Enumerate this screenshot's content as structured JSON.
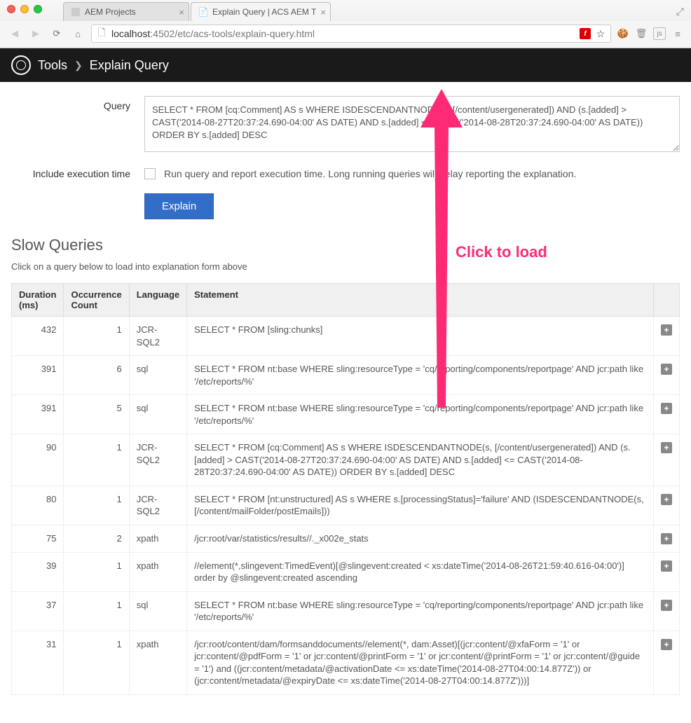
{
  "browser": {
    "tabs": [
      {
        "title": "AEM Projects",
        "active": false
      },
      {
        "title": "Explain Query | ACS AEM T",
        "active": true
      }
    ],
    "url_host": "localhost",
    "url_port": ":4502",
    "url_path": "/etc/acs-tools/explain-query.html"
  },
  "header": {
    "breadcrumb_root": "Tools",
    "breadcrumb_current": "Explain Query"
  },
  "form": {
    "query_label": "Query",
    "query_value": "SELECT * FROM [cq:Comment] AS s WHERE ISDESCENDANTNODE(s, [/content/usergenerated]) AND (s.[added] > CAST('2014-08-27T20:37:24.690-04:00' AS DATE) AND s.[added] <= CAST('2014-08-28T20:37:24.690-04:00' AS DATE)) ORDER BY s.[added] DESC",
    "exec_label": "Include execution time",
    "exec_desc": "Run query and report execution time. Long running queries will delay reporting the explanation.",
    "explain_btn": "Explain"
  },
  "section": {
    "title": "Slow Queries",
    "subtitle": "Click on a query below to load into explanation form above"
  },
  "table": {
    "headers": {
      "duration": "Duration (ms)",
      "occurrence": "Occurrence Count",
      "language": "Language",
      "statement": "Statement"
    },
    "rows": [
      {
        "duration": "432",
        "occurrence": "1",
        "language": "JCR-SQL2",
        "statement": "SELECT * FROM [sling:chunks]"
      },
      {
        "duration": "391",
        "occurrence": "6",
        "language": "sql",
        "statement": "SELECT * FROM nt:base WHERE sling:resourceType = 'cq/reporting/components/reportpage' AND jcr:path like '/etc/reports/%'"
      },
      {
        "duration": "391",
        "occurrence": "5",
        "language": "sql",
        "statement": "SELECT * FROM nt:base WHERE sling:resourceType = 'cq/reporting/components/reportpage' AND jcr:path like '/etc/reports/%'"
      },
      {
        "duration": "90",
        "occurrence": "1",
        "language": "JCR-SQL2",
        "statement": "SELECT * FROM [cq:Comment] AS s WHERE ISDESCENDANTNODE(s, [/content/usergenerated]) AND (s.[added] > CAST('2014-08-27T20:37:24.690-04:00' AS DATE) AND s.[added] <= CAST('2014-08-28T20:37:24.690-04:00' AS DATE)) ORDER BY s.[added] DESC"
      },
      {
        "duration": "80",
        "occurrence": "1",
        "language": "JCR-SQL2",
        "statement": "SELECT * FROM [nt:unstructured] AS s WHERE s.[processingStatus]='failure' AND (ISDESCENDANTNODE(s, [/content/mailFolder/postEmails]))"
      },
      {
        "duration": "75",
        "occurrence": "2",
        "language": "xpath",
        "statement": "/jcr:root/var/statistics/results//._x002e_stats"
      },
      {
        "duration": "39",
        "occurrence": "1",
        "language": "xpath",
        "statement": "//element(*,slingevent:TimedEvent)[@slingevent:created < xs:dateTime('2014-08-26T21:59:40.616-04:00')] order by @slingevent:created ascending"
      },
      {
        "duration": "37",
        "occurrence": "1",
        "language": "sql",
        "statement": "SELECT * FROM nt:base WHERE sling:resourceType = 'cq/reporting/components/reportpage' AND jcr:path like '/etc/reports/%'"
      },
      {
        "duration": "31",
        "occurrence": "1",
        "language": "xpath",
        "statement": "/jcr:root/content/dam/formsanddocuments//element(*, dam:Asset)[(jcr:content/@xfaForm = '1' or jcr:content/@pdfForm = '1' or jcr:content/@printForm = '1' or jcr:content/@printForm = '1' or jcr:content/@guide = '1') and ((jcr:content/metadata/@activationDate <= xs:dateTime('2014-08-27T04:00:14.877Z')) or (jcr:content/metadata/@expiryDate <= xs:dateTime('2014-08-27T04:00:14.877Z')))]"
      }
    ]
  },
  "annotation": {
    "text": "Click to load"
  }
}
